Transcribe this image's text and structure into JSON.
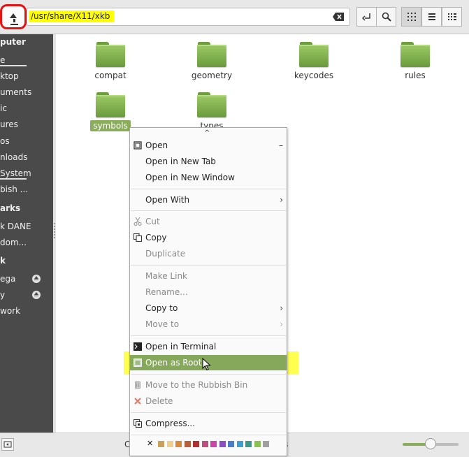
{
  "toolbar": {
    "path": "/usr/share/X11/xkb",
    "buttons": [
      "go-up-icon",
      "clear-icon",
      "toggle-location-icon",
      "search-icon",
      "icon-view-icon",
      "list-view-icon",
      "compact-view-icon"
    ]
  },
  "sidebar": {
    "items": [
      {
        "label": "puter",
        "type": "heading"
      },
      {
        "label": "e",
        "type": "item",
        "underline": true
      },
      {
        "label": "ktop",
        "type": "item"
      },
      {
        "label": "uments",
        "type": "item"
      },
      {
        "label": "ic",
        "type": "item"
      },
      {
        "label": "ures",
        "type": "item"
      },
      {
        "label": "os",
        "type": "item"
      },
      {
        "label": "nloads",
        "type": "item"
      },
      {
        "label": "System",
        "type": "item",
        "underline": true
      },
      {
        "label": "bish ...",
        "type": "item"
      },
      {
        "label": "arks",
        "type": "heading"
      },
      {
        "label": "k DANE",
        "type": "item"
      },
      {
        "label": "dom...",
        "type": "item"
      },
      {
        "label": "k",
        "type": "heading"
      },
      {
        "label": "ega",
        "type": "item",
        "eject": true
      },
      {
        "label": "y",
        "type": "item",
        "eject": true
      },
      {
        "label": "work",
        "type": "item"
      }
    ]
  },
  "folders": [
    {
      "name": "compat",
      "selected": false
    },
    {
      "name": "geometry",
      "selected": false
    },
    {
      "name": "keycodes",
      "selected": false
    },
    {
      "name": "rules",
      "selected": false
    },
    {
      "name": "symbols",
      "selected": true
    },
    {
      "name": "types",
      "selected": false
    }
  ],
  "context_menu": {
    "scroll_up": "^",
    "items": [
      {
        "label": "Open",
        "icon": "open-icon",
        "shortcut": "–"
      },
      {
        "label": "Open in New Tab"
      },
      {
        "label": "Open in New Window"
      },
      {
        "label": "Open With",
        "submenu": true
      },
      {
        "label": "Cut",
        "icon": "scissors-icon",
        "disabled": true
      },
      {
        "label": "Copy",
        "icon": "copy-icon"
      },
      {
        "label": "Duplicate",
        "disabled": true
      },
      {
        "label": "Make Link",
        "disabled": true
      },
      {
        "label": "Rename...",
        "disabled": true
      },
      {
        "label": "Copy to",
        "submenu": true
      },
      {
        "label": "Move to",
        "submenu": true,
        "disabled": true
      },
      {
        "label": "Open in Terminal",
        "icon": "terminal-icon"
      },
      {
        "label": "Open as Root",
        "icon": "root-icon",
        "highlighted": true
      },
      {
        "label": "Move to the Rubbish Bin",
        "icon": "trash-icon",
        "disabled": true
      },
      {
        "label": "Delete",
        "icon": "delete-icon",
        "disabled": true
      },
      {
        "label": "Compress...",
        "icon": "compress-icon"
      }
    ],
    "emblem_colors": [
      "#c8a25a",
      "#ecd08c",
      "#d88a3a",
      "#b8603a",
      "#b03030",
      "#c04c80",
      "#cc44aa",
      "#8a50c0",
      "#4a7ec8",
      "#3aa0d0",
      "#3a9a8a",
      "#8cc050",
      "#a0a0a0"
    ]
  },
  "statusbar": {
    "text_left": "C",
    "text_right": "s",
    "zoom_level": 0.5
  }
}
